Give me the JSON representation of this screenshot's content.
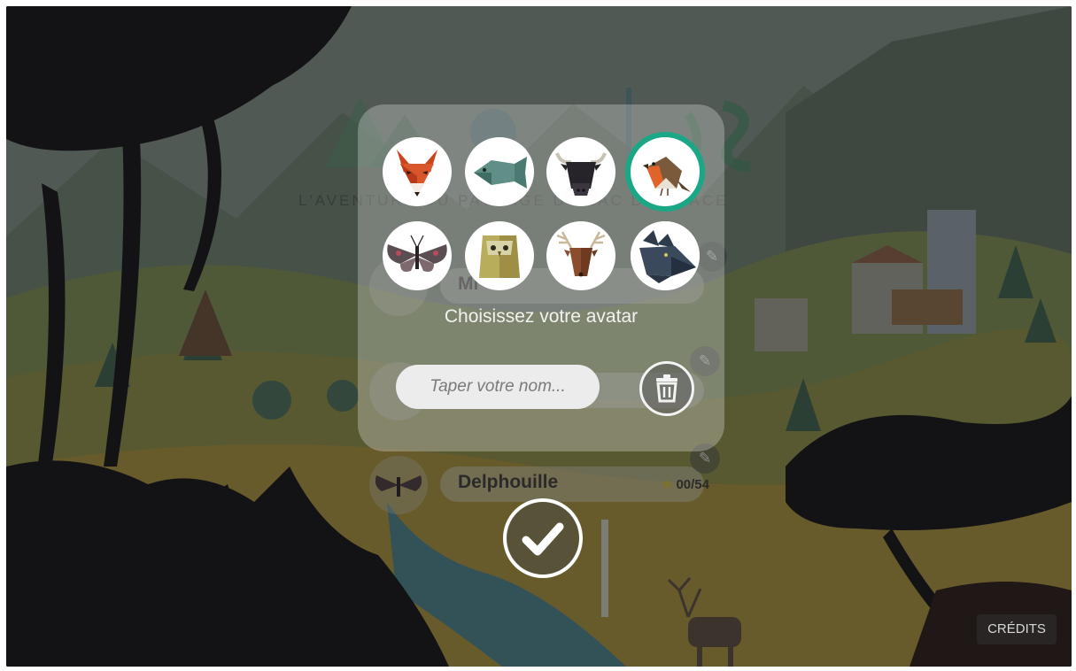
{
  "app": {
    "logo_text": "Arbhosis",
    "tagline": "L'AVENTURE DU PAYSAGE DU LAC DE GLACE"
  },
  "modal": {
    "caption": "Choisissez votre avatar",
    "name_placeholder": "Taper votre nom...",
    "selected_avatar": "robin",
    "avatars": [
      {
        "name": "fox",
        "icon": "fox-icon"
      },
      {
        "name": "fish",
        "icon": "fish-icon"
      },
      {
        "name": "bull",
        "icon": "bull-icon"
      },
      {
        "name": "robin",
        "icon": "robin-icon"
      },
      {
        "name": "butterfly",
        "icon": "butterfly-icon"
      },
      {
        "name": "owl",
        "icon": "owl-icon"
      },
      {
        "name": "deer",
        "icon": "deer-icon"
      },
      {
        "name": "wolf",
        "icon": "wolf-icon"
      }
    ],
    "accent_color": "#1aa786"
  },
  "players": [
    {
      "name": "Mi",
      "score": ""
    },
    {
      "name": "",
      "score": ""
    },
    {
      "name": "Delphouille",
      "score": "00/54"
    }
  ],
  "footer": {
    "credits_label": "CRÉDITS"
  }
}
